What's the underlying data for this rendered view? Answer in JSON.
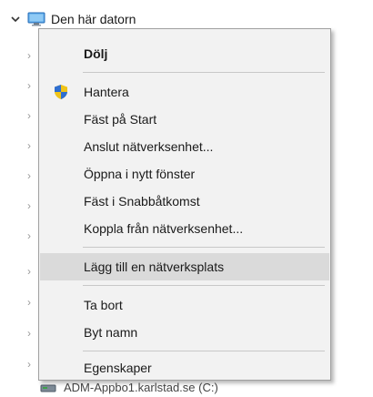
{
  "tree": {
    "root_label": "Den här datorn",
    "bottom_label": "ADM-Appbo1.karlstad.se (C:)"
  },
  "context_menu": {
    "items": [
      {
        "label": "Dölj",
        "bold": true
      },
      {
        "label": "Hantera",
        "icon": "uac-shield-icon"
      },
      {
        "label": "Fäst på Start"
      },
      {
        "label": "Anslut nätverksenhet..."
      },
      {
        "label": "Öppna i nytt fönster"
      },
      {
        "label": "Fäst i Snabbåtkomst"
      },
      {
        "label": "Koppla från nätverksenhet..."
      },
      {
        "label": "Lägg till en nätverksplats",
        "highlighted": true
      },
      {
        "label": "Ta bort"
      },
      {
        "label": "Byt namn"
      },
      {
        "label": "Egenskaper"
      }
    ]
  },
  "colors": {
    "menu_background": "#f2f2f2",
    "menu_highlight": "#dadada",
    "separator": "#c8c8c8",
    "shield_blue": "#2f6fd1",
    "shield_yellow": "#f0c419"
  }
}
